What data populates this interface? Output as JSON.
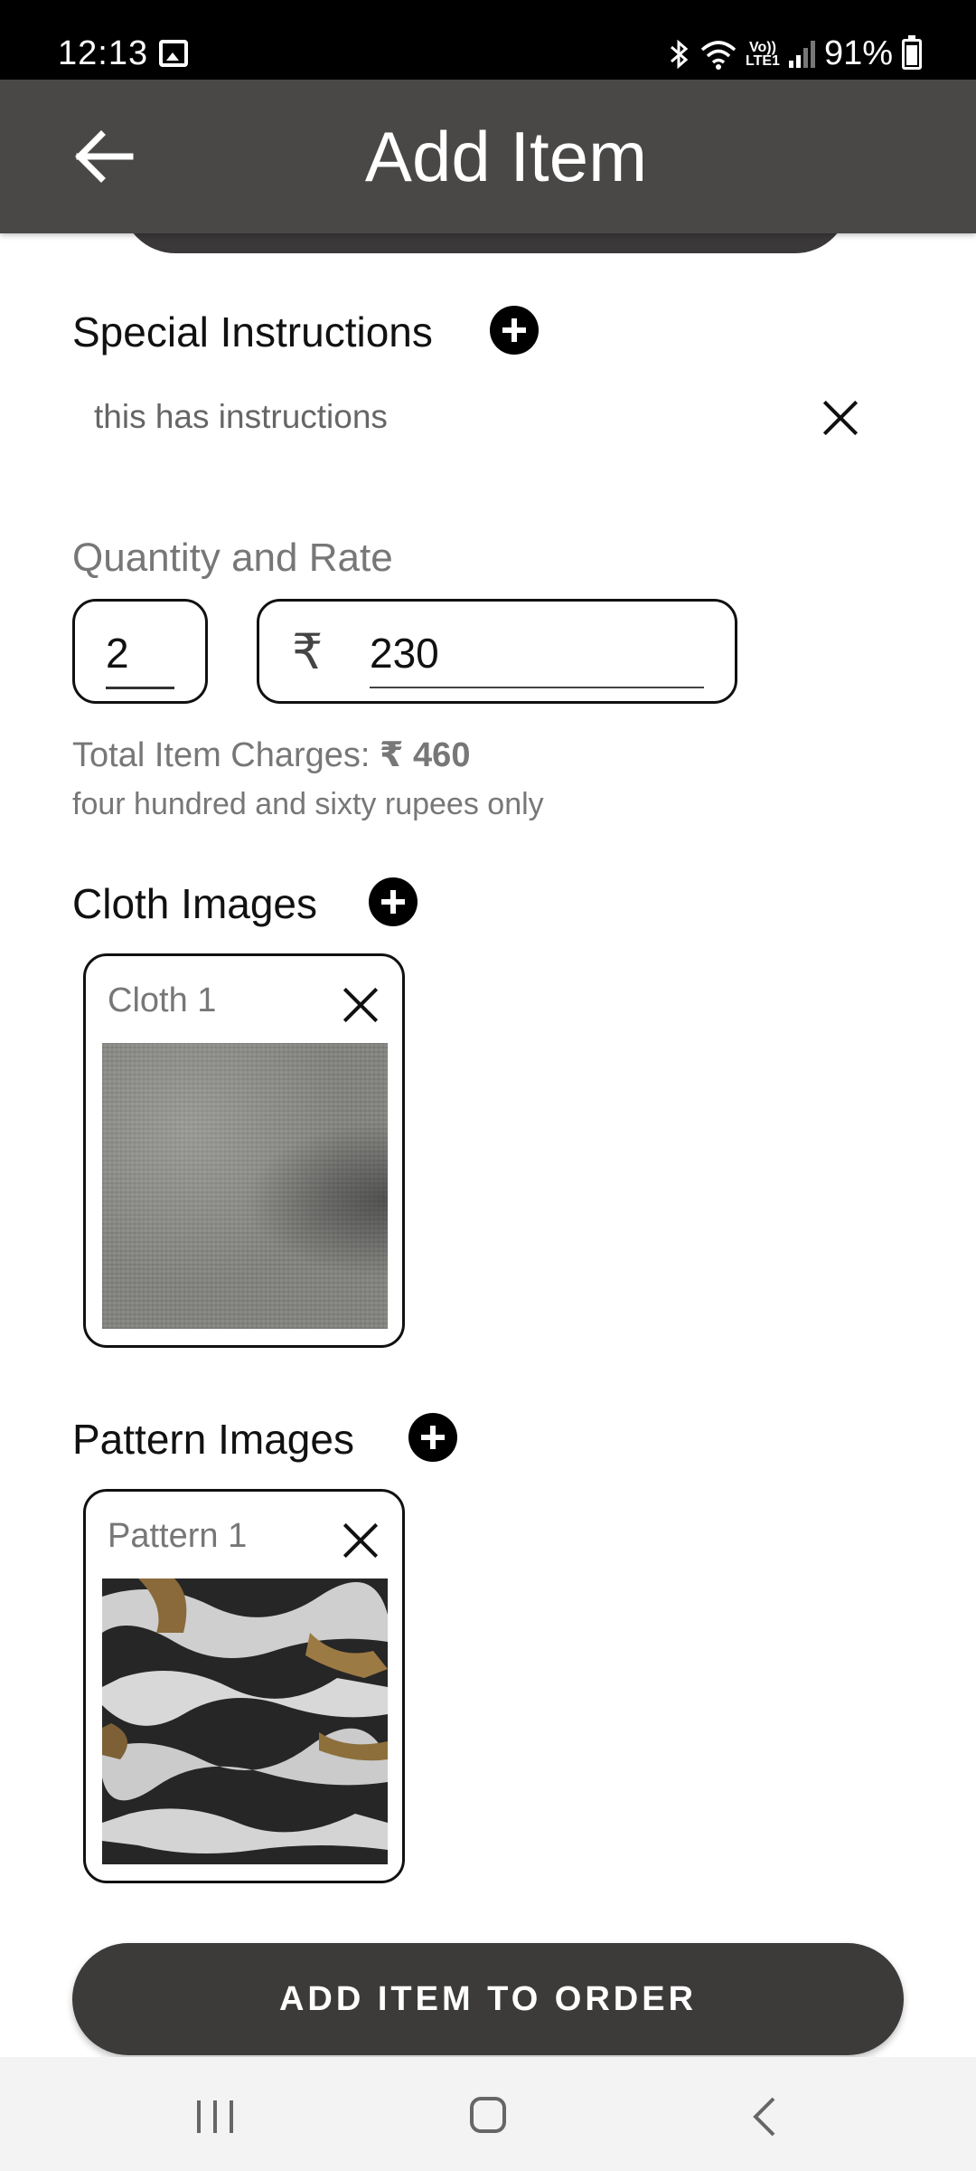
{
  "status_bar": {
    "time": "12:13",
    "volte_top": "Vo))",
    "volte_bottom": "LTE1",
    "battery": "91%"
  },
  "header": {
    "title": "Add Item",
    "back_icon": "arrow-left-icon",
    "background": "#4a4847"
  },
  "special_instructions": {
    "title": "Special Instructions",
    "items": [
      {
        "text": "this has instructions"
      }
    ]
  },
  "quantity_rate": {
    "label": "Quantity and Rate",
    "quantity": "2",
    "currency_symbol": "₹",
    "rate": "230"
  },
  "total": {
    "label": "Total Item Charges:",
    "amount": "₹ 460",
    "in_words": "four hundred and sixty  rupees only"
  },
  "cloth_images": {
    "title": "Cloth Images",
    "items": [
      {
        "label": "Cloth 1"
      }
    ]
  },
  "pattern_images": {
    "title": "Pattern Images",
    "items": [
      {
        "label": "Pattern 1"
      }
    ]
  },
  "submit_button": {
    "label": "ADD ITEM TO ORDER",
    "background": "#3d3b3a"
  },
  "navigation": {
    "icons": [
      "recent-apps-icon",
      "home-icon",
      "back-icon"
    ]
  }
}
